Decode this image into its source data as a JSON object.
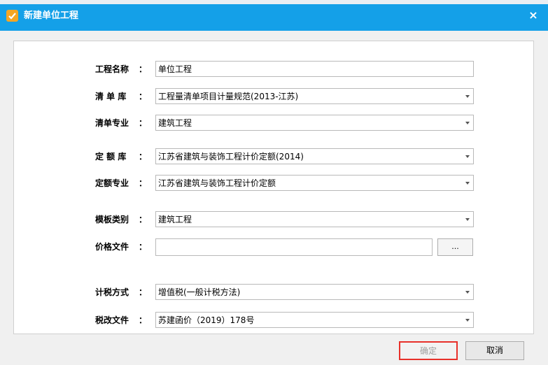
{
  "dialog": {
    "title": "新建单位工程",
    "close_label": "×"
  },
  "form": {
    "project_name": {
      "label": "工程名称",
      "value": "单位工程"
    },
    "bill_library": {
      "label": "清 单 库",
      "value": "工程量清单项目计量规范(2013-江苏)"
    },
    "bill_specialty": {
      "label": "清单专业",
      "value": "建筑工程"
    },
    "quota_library": {
      "label": "定 额 库",
      "value": "江苏省建筑与装饰工程计价定额(2014)"
    },
    "quota_specialty": {
      "label": "定额专业",
      "value": "江苏省建筑与装饰工程计价定额"
    },
    "template_category": {
      "label": "模板类别",
      "value": "建筑工程"
    },
    "price_file": {
      "label": "价格文件",
      "value": "",
      "browse_label": "..."
    },
    "tax_method": {
      "label": "计税方式",
      "value": "增值税(一般计税方法)"
    },
    "tax_reform_file": {
      "label": "税改文件",
      "value": "苏建函价（2019）178号"
    },
    "colon": "："
  },
  "buttons": {
    "ok_label": "确定",
    "cancel_label": "取消"
  }
}
